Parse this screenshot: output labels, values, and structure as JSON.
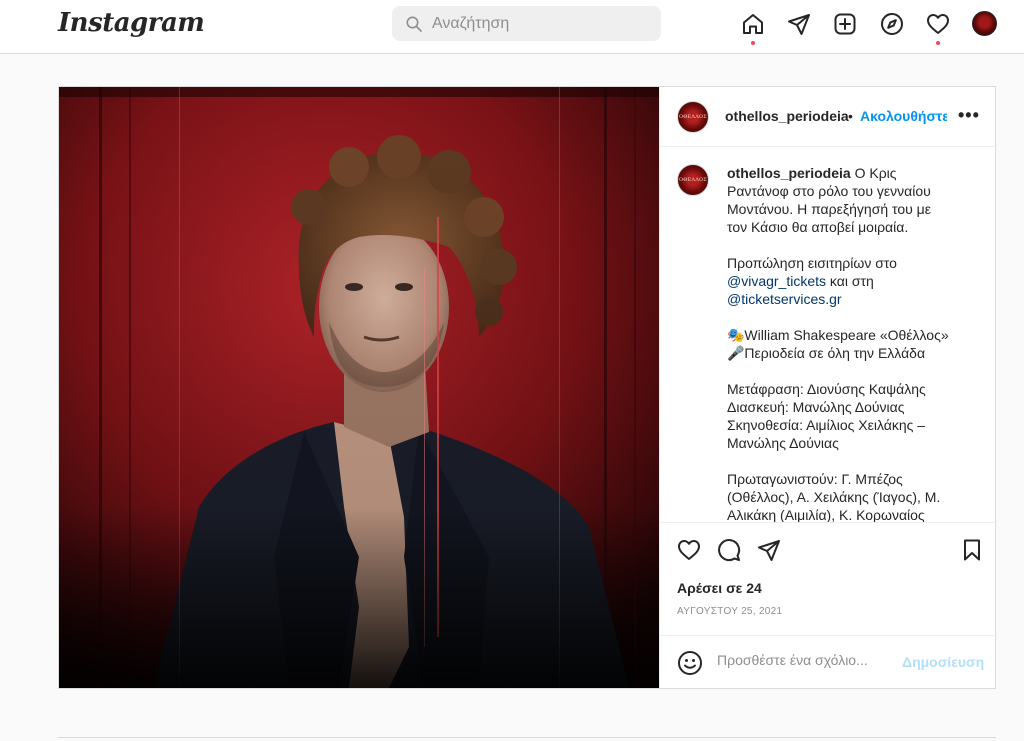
{
  "nav": {
    "logo": "Instagram",
    "search_placeholder": "Αναζήτηση",
    "icons": [
      "home-icon",
      "direct-message-icon",
      "new-post-icon",
      "explore-icon",
      "activity-heart-icon",
      "profile-avatar"
    ]
  },
  "post": {
    "username": "othellos_periodeia",
    "separator": "•",
    "follow_label": "Ακολουθήστε",
    "more_label": "•••",
    "avatar_text": "ΟΘΕΛΛΟΣ",
    "caption": {
      "username": "othellos_periodeia",
      "text1": "Ο Κρις Ραντάνοφ στο ρόλο του γενναίου Μοντάνου. Η παρεξήγησή του με τον Κάσιο θα αποβεί μοιραία.",
      "presale_prefix": "Προπώληση εισιτηρίων στο",
      "mention1": "@vivagr_tickets",
      "presale_middle": "και στη",
      "mention2": "@ticketservices.gr",
      "line_play": "🎭William Shakespeare «Οθέλλος»",
      "line_tour": "🎤Περιοδεία σε όλη την Ελλάδα",
      "line_translation": "Μετάφραση: Διονύσης Καψάλης",
      "line_adaptation": "Διασκευή: Μανώλης Δούνιας",
      "line_direction": "Σκηνοθεσία: Αιμίλιος Χειλάκης – Μανώλης Δούνιας",
      "line_cast": "Πρωταγωνιστούν: Γ. Μπέζος (Οθέλλος), Α. Χειλάκης (Ίαγος), Μ. Αλικάκη (Αιμιλία), Κ. Κορωναίος"
    },
    "likes": "Αρέσει σε 24",
    "date": "ΑΥΓΟΥΣΤΟΥ 25, 2021",
    "comment_placeholder": "Προσθέστε ένα σχόλιο...",
    "publish_label": "Δημοσίευση"
  },
  "colors": {
    "accent": "#0095f6",
    "notification": "#ed4956",
    "publish_disabled": "#b2dffc"
  }
}
